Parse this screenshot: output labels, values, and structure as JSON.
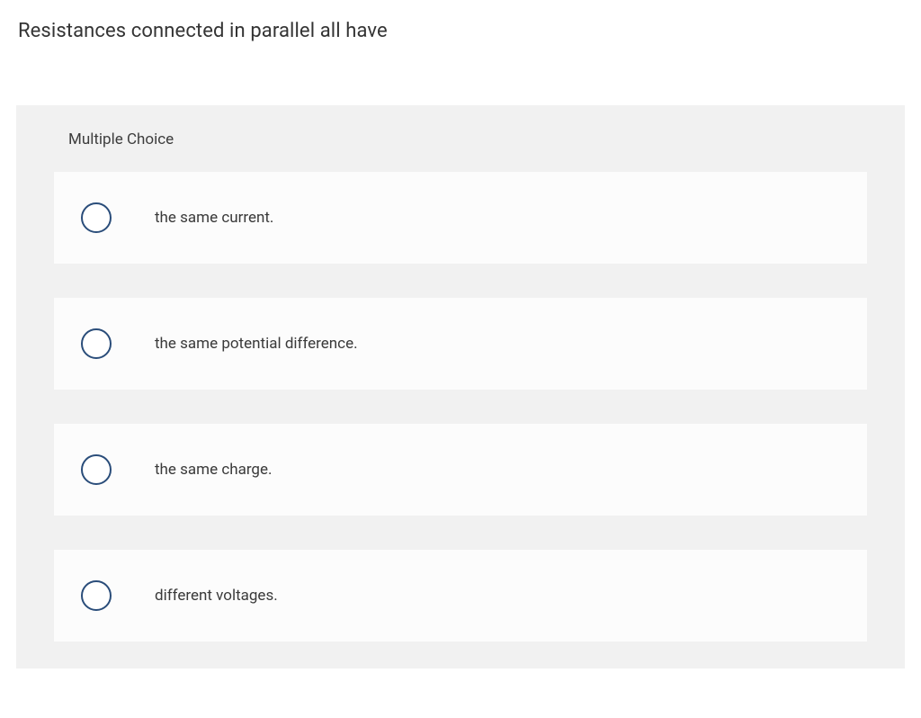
{
  "question": "Resistances connected in parallel all have",
  "section_label": "Multiple Choice",
  "options": [
    {
      "label": "the same current."
    },
    {
      "label": "the same potential difference."
    },
    {
      "label": "the same charge."
    },
    {
      "label": "different voltages."
    }
  ]
}
